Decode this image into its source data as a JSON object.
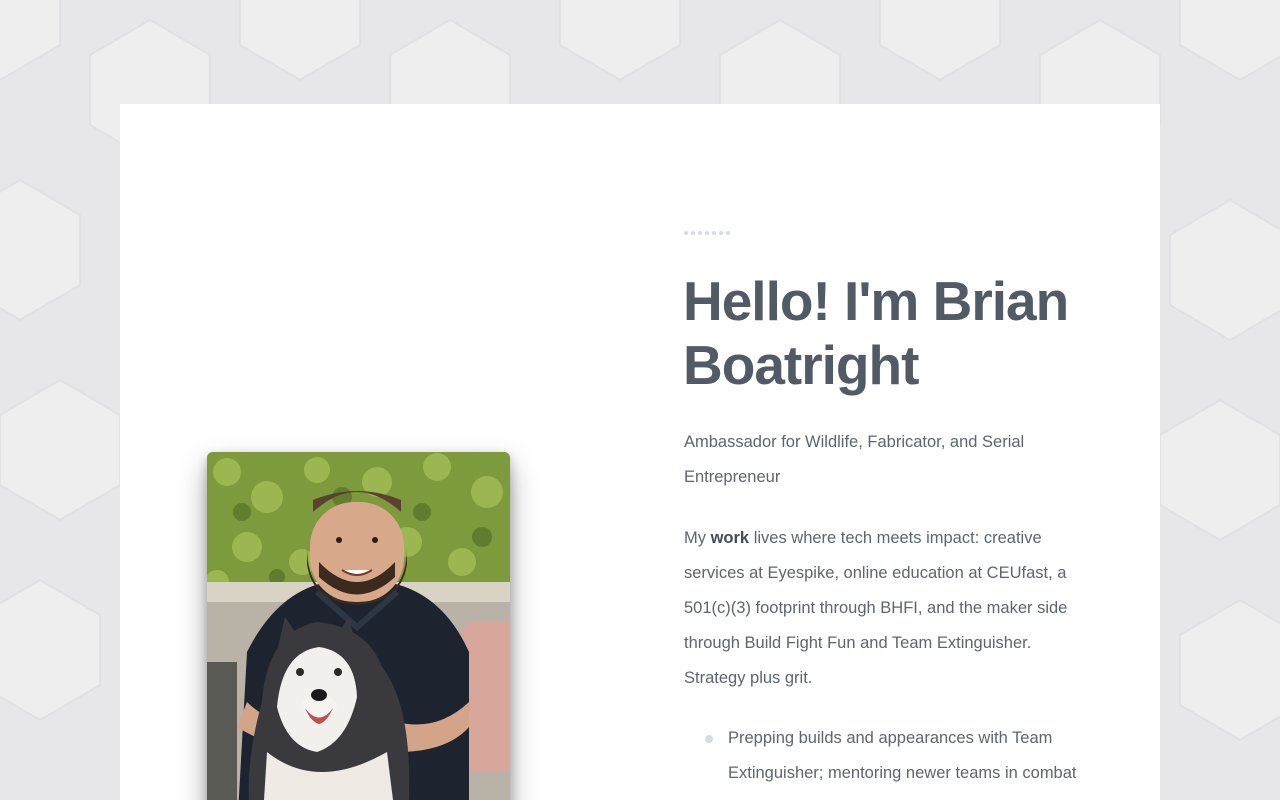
{
  "profile": {
    "heading": "Hello! I'm Brian Boatright",
    "subtitle": "Ambassador for Wildlife, Fabricator, and Serial Entrepreneur",
    "bio_prefix": "My ",
    "bio_emphasis": "work",
    "bio_rest": " lives where tech meets impact: creative services at Eyespike, online education at CEUfast, a 501(c)(3) footprint through BHFI, and the maker side through Build Fight Fun and Team Extinguisher. Strategy plus grit.",
    "highlights": [
      "Prepping builds and appearances with Team Extinguisher; mentoring newer teams in combat"
    ]
  },
  "colors": {
    "page_background": "#e6e6e8",
    "card_background": "#ffffff",
    "heading": "#525a66",
    "body_text": "#5e6570",
    "accent_dots": "#d3dbe6"
  },
  "icons": {
    "decorative_dots": "dotted-line-decoration",
    "list_bullet": "bullet-dot"
  }
}
